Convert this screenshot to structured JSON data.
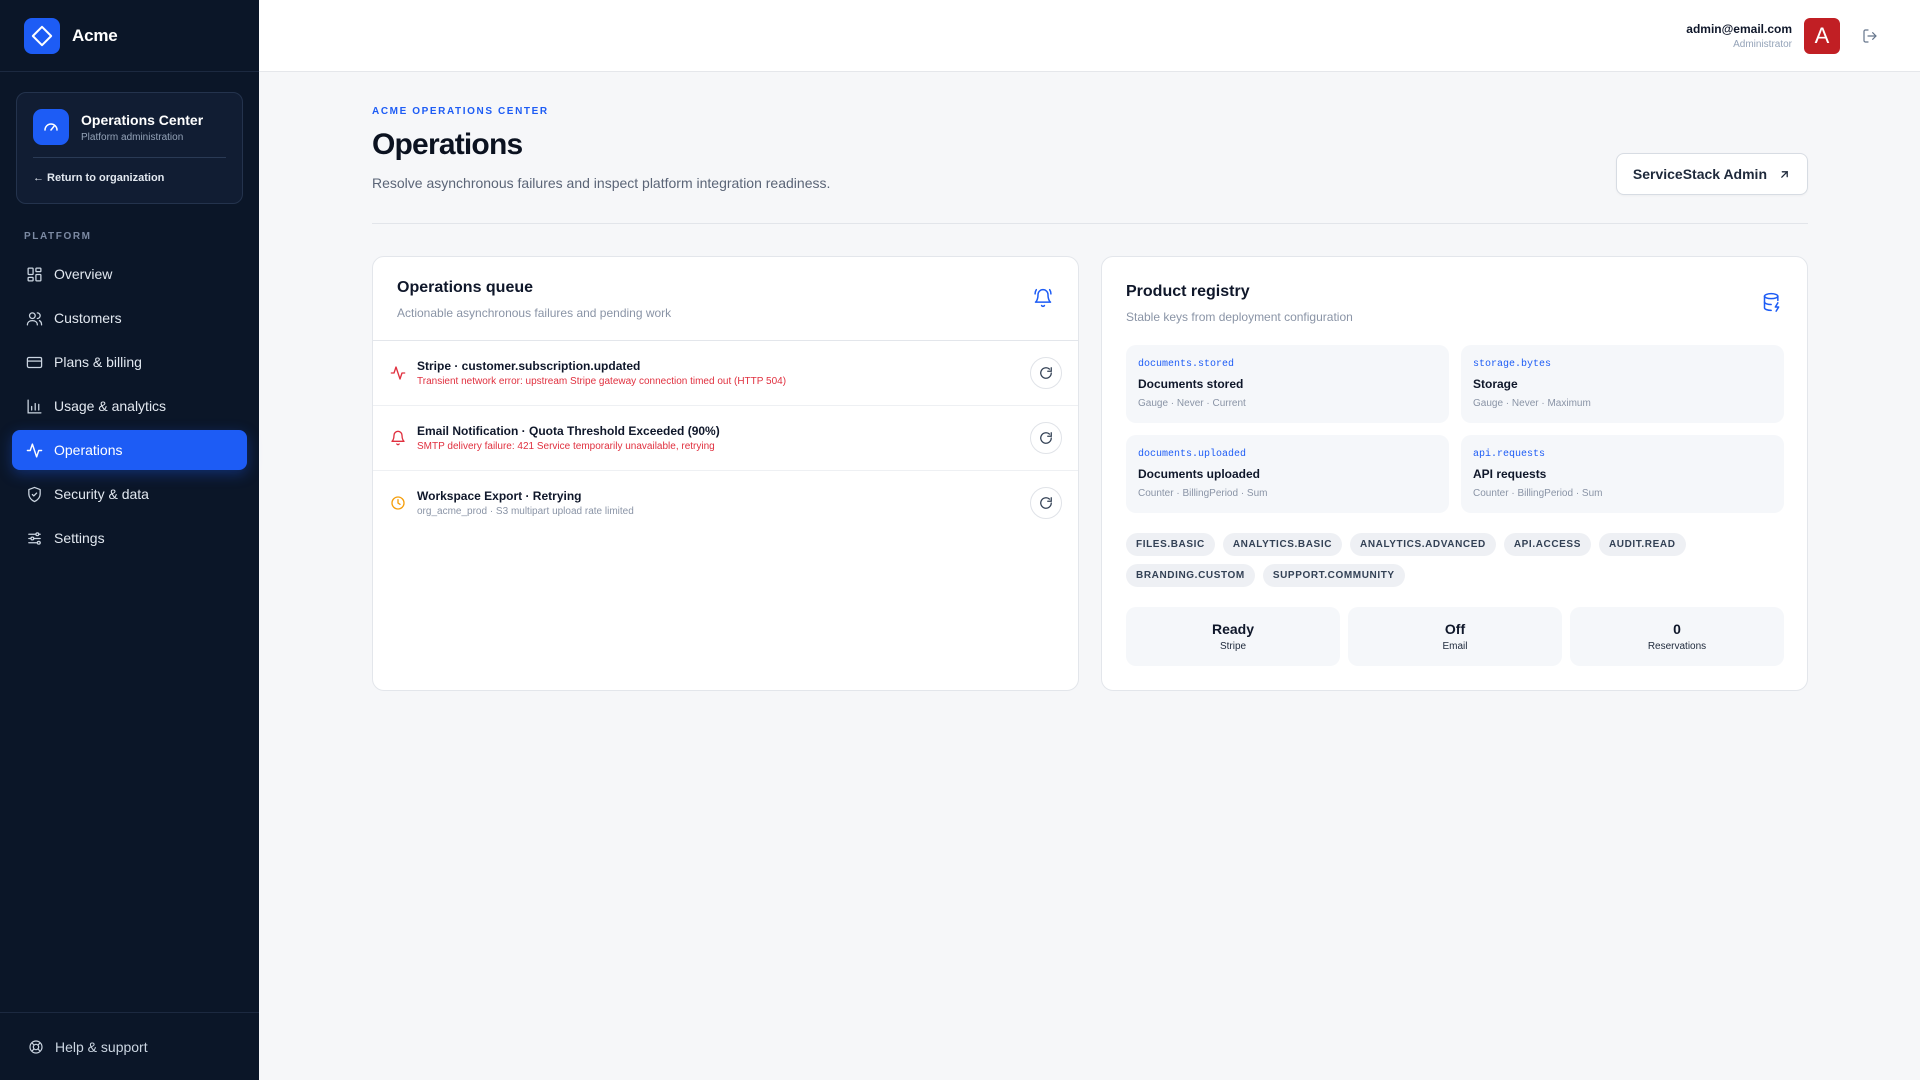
{
  "brand": {
    "name": "Acme"
  },
  "ops_card": {
    "title": "Operations Center",
    "subtitle": "Platform administration",
    "return_link": "← Return to organization"
  },
  "nav": {
    "section_label": "PLATFORM",
    "items": [
      {
        "label": "Overview",
        "icon": "grid-icon"
      },
      {
        "label": "Customers",
        "icon": "users-icon"
      },
      {
        "label": "Plans & billing",
        "icon": "credit-card-icon"
      },
      {
        "label": "Usage & analytics",
        "icon": "bar-chart-icon"
      },
      {
        "label": "Operations",
        "icon": "activity-icon",
        "active": true
      },
      {
        "label": "Security & data",
        "icon": "shield-check-icon"
      },
      {
        "label": "Settings",
        "icon": "sliders-icon"
      }
    ],
    "footer": {
      "label": "Help & support",
      "icon": "lifebuoy-icon"
    }
  },
  "header": {
    "user_email": "admin@email.com",
    "user_role": "Administrator",
    "avatar_letter": "A",
    "avatar_color": "#c11f24"
  },
  "page": {
    "eyebrow": "ACME OPERATIONS CENTER",
    "title": "Operations",
    "subtitle": "Resolve asynchronous failures and inspect platform integration readiness.",
    "external_button": "ServiceStack Admin"
  },
  "queue": {
    "title": "Operations queue",
    "subtitle": "Actionable asynchronous failures and pending work",
    "items": [
      {
        "icon": "activity-icon",
        "title": "Stripe · customer.subscription.updated",
        "detail": "Transient network error: upstream Stripe gateway connection timed out (HTTP 504)",
        "severity": "error"
      },
      {
        "icon": "bell-icon",
        "title": "Email Notification · Quota Threshold Exceeded (90%)",
        "detail": "SMTP delivery failure: 421 Service temporarily unavailable, retrying",
        "severity": "error"
      },
      {
        "icon": "clock-icon",
        "title": "Workspace Export · Retrying",
        "detail": "org_acme_prod · S3 multipart upload rate limited",
        "severity": "pending"
      }
    ]
  },
  "registry": {
    "title": "Product registry",
    "subtitle": "Stable keys from deployment configuration",
    "keys": [
      {
        "code": "documents.stored",
        "name": "Documents stored",
        "meta": "Gauge · Never · Current"
      },
      {
        "code": "storage.bytes",
        "name": "Storage",
        "meta": "Gauge · Never · Maximum"
      },
      {
        "code": "documents.uploaded",
        "name": "Documents uploaded",
        "meta": "Counter · BillingPeriod · Sum"
      },
      {
        "code": "api.requests",
        "name": "API requests",
        "meta": "Counter · BillingPeriod · Sum"
      }
    ],
    "features": [
      "FILES.BASIC",
      "ANALYTICS.BASIC",
      "ANALYTICS.ADVANCED",
      "API.ACCESS",
      "AUDIT.READ",
      "BRANDING.CUSTOM",
      "SUPPORT.COMMUNITY"
    ],
    "stats": [
      {
        "value": "Ready",
        "label": "Stripe"
      },
      {
        "value": "Off",
        "label": "Email"
      },
      {
        "value": "0",
        "label": "Reservations"
      }
    ]
  },
  "colors": {
    "accent": "#1d5cf5",
    "sidebar_bg": "#0b1628",
    "error": "#e0303f",
    "warning": "#f59e0b"
  }
}
